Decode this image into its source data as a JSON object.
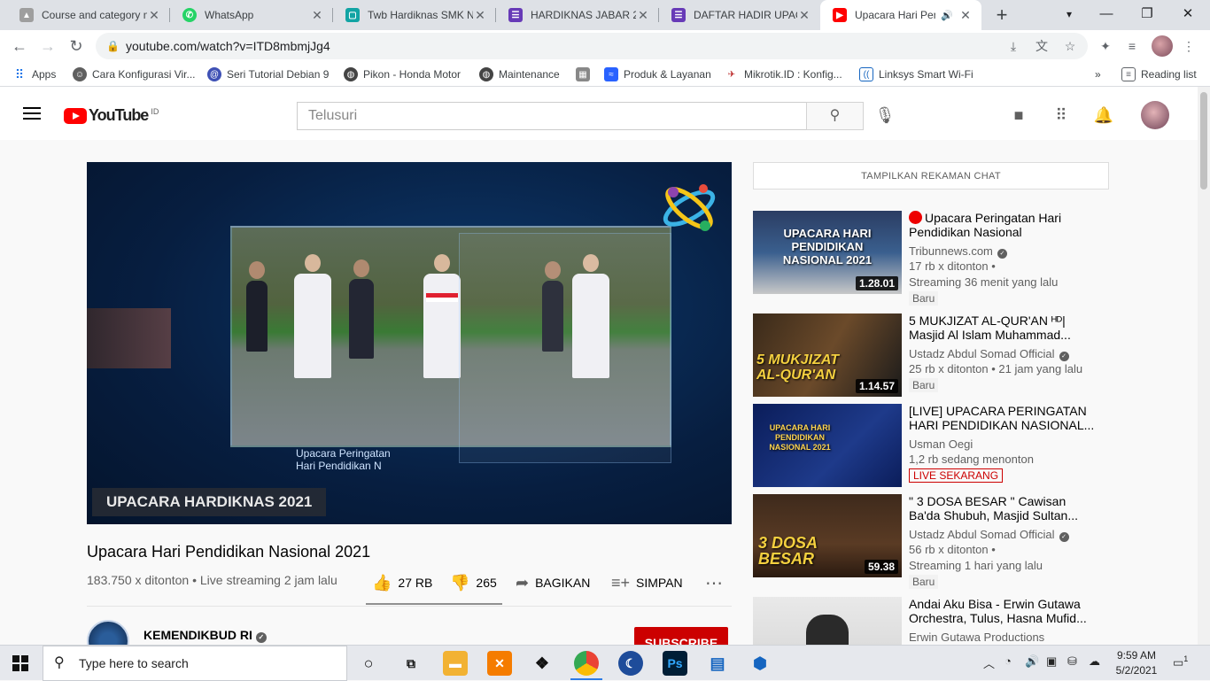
{
  "browser": {
    "tabs": [
      {
        "title": "Course and category m",
        "icon_color": "#8a8a8a"
      },
      {
        "title": "WhatsApp",
        "icon_color": "#25d366"
      },
      {
        "title": "Twb Hardiknas SMK N",
        "icon_color": "#12a4a4"
      },
      {
        "title": "HARDIKNAS JABAR 20",
        "icon_color": "#673ab7"
      },
      {
        "title": "DAFTAR HADIR UPACA",
        "icon_color": "#673ab7"
      },
      {
        "title": "Upacara Hari Pend",
        "icon_color": "#ff0000"
      }
    ],
    "new_tab": "+",
    "url": "youtube.com/watch?v=ITD8mbmjJg4",
    "reading_list": "Reading list",
    "bookmarks_more": "»",
    "bookmarks": [
      {
        "label": "Apps"
      },
      {
        "label": "Cara Konfigurasi Vir..."
      },
      {
        "label": "Seri Tutorial Debian 9"
      },
      {
        "label": "Pikon - Honda Motor"
      },
      {
        "label": "Maintenance"
      },
      {
        "label": ""
      },
      {
        "label": "Produk & Layanan"
      },
      {
        "label": "Mikrotik.ID : Konfig..."
      },
      {
        "label": "Linksys Smart Wi-Fi"
      }
    ]
  },
  "youtube": {
    "logo_text": "YouTube",
    "country_code": "ID",
    "search_placeholder": "Telusuri",
    "video": {
      "title": "Upacara Hari Pendidikan Nasional 2021",
      "meta": "183.750 x ditonton • Live streaming 2 jam lalu",
      "likes": "27 RB",
      "dislikes": "265",
      "share_label": "BAGIKAN",
      "save_label": "SIMPAN",
      "overlay_caption_1": "Upacara Peringatan",
      "overlay_caption_2": "Hari Pendidikan N",
      "overlay_banner": "UPACARA HARDIKNAS 2021"
    },
    "channel": {
      "name": "KEMENDIKBUD RI",
      "subscribe_label": "SUBSCRIBE"
    },
    "chat_button": "TAMPILKAN REKAMAN CHAT",
    "recommendations": [
      {
        "title": "Upacara Peringatan Hari Pendidikan Nasional",
        "channel": "Tribunnews.com",
        "stat1": "17 rb x ditonton •",
        "stat2": "Streaming 36 menit yang lalu",
        "badge": "Baru",
        "duration": "1.28.01",
        "thumb_text": "UPACARA HARI PENDIDIKAN NASIONAL 2021",
        "live_dot": true
      },
      {
        "title": "5 MUKJIZAT AL-QUR'AN ᴴᴰ| Masjid Al Islam Muhammad...",
        "channel": "Ustadz Abdul Somad Official",
        "stat1": "25 rb x ditonton • 21 jam yang lalu",
        "stat2": "",
        "badge": "Baru",
        "duration": "1.14.57",
        "thumb_text": "5 MUKJIZAT AL-QUR'AN",
        "live_dot": false
      },
      {
        "title": "[LIVE] UPACARA PERINGATAN HARI PENDIDIKAN NASIONAL...",
        "channel": "Usman Oegi",
        "stat1": "1,2 rb sedang menonton",
        "stat2": "",
        "badge": "LIVE SEKARANG",
        "duration": "",
        "thumb_text": "UPACARA HARI PENDIDIKAN NASIONAL 2021",
        "live_dot": false
      },
      {
        "title": "\" 3 DOSA BESAR \" Cawisan Ba'da Shubuh, Masjid Sultan...",
        "channel": "Ustadz Abdul Somad Official",
        "stat1": "56 rb x ditonton •",
        "stat2": "Streaming 1 hari yang lalu",
        "badge": "Baru",
        "duration": "59.38",
        "thumb_text": "3 DOSA BESAR",
        "live_dot": false
      },
      {
        "title": "Andai Aku Bisa - Erwin Gutawa Orchestra, Tulus, Hasna Mufid...",
        "channel": "Erwin Gutawa Productions",
        "stat1": "",
        "stat2": "",
        "badge": "",
        "duration": "",
        "thumb_text": "",
        "live_dot": false
      }
    ]
  },
  "taskbar": {
    "search_placeholder": "Type here to search",
    "time": "9:59 AM",
    "date": "5/2/2021",
    "notification_count": "1"
  }
}
